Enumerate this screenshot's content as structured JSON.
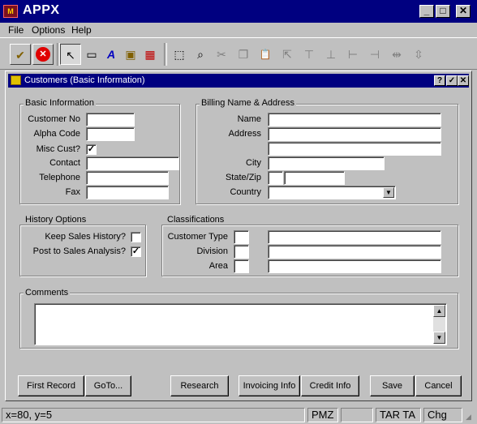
{
  "app": {
    "title": "APPX",
    "logo_text": "M"
  },
  "menu": [
    "File",
    "Options",
    "Help"
  ],
  "toolbar": {
    "tools": [
      {
        "icon": "checkbox-edit-icon",
        "glyph": "✔"
      },
      {
        "icon": "cancel-icon",
        "glyph": "✕"
      },
      {
        "icon": "pointer-icon",
        "glyph": "↖"
      },
      {
        "icon": "rectangle-icon",
        "glyph": "▭"
      },
      {
        "icon": "text-tool-icon",
        "glyph": "A"
      },
      {
        "icon": "image-icon",
        "glyph": "▣"
      },
      {
        "icon": "calendar-icon",
        "glyph": "▦"
      },
      {
        "icon": "select-box-icon",
        "glyph": "⬚"
      },
      {
        "icon": "find-icon",
        "glyph": "⌕"
      },
      {
        "icon": "cut-icon",
        "glyph": "✂"
      },
      {
        "icon": "copy-icon",
        "glyph": "❐"
      },
      {
        "icon": "paste-icon",
        "glyph": "📋"
      },
      {
        "icon": "export-icon",
        "glyph": "⇱"
      },
      {
        "icon": "align-top-icon",
        "glyph": "⊤"
      },
      {
        "icon": "align-bottom-icon",
        "glyph": "⊥"
      },
      {
        "icon": "align-left-icon",
        "glyph": "⊢"
      },
      {
        "icon": "align-right-icon",
        "glyph": "⊣"
      },
      {
        "icon": "same-width-icon",
        "glyph": "⇹"
      },
      {
        "icon": "same-height-icon",
        "glyph": "⇳"
      }
    ]
  },
  "window": {
    "title": "Customers (Basic Information)",
    "help_btn": "?",
    "ok_btn": "✓",
    "close_btn": "✕"
  },
  "basic": {
    "group_label": "Basic Information",
    "customer_no": "Customer No",
    "alpha_code": "Alpha Code",
    "misc_cust": "Misc Cust?",
    "misc_cust_checked": "✓",
    "contact": "Contact",
    "telephone": "Telephone",
    "fax": "Fax"
  },
  "billing": {
    "group_label": "Billing Name & Address",
    "name": "Name",
    "address": "Address",
    "city": "City",
    "state_zip": "State/Zip",
    "country": "Country",
    "country_arrow": "▼"
  },
  "history": {
    "group_label": "History Options",
    "keep_sales": "Keep Sales History?",
    "keep_sales_checked": "",
    "post_sales": "Post to Sales Analysis?",
    "post_sales_checked": "✓"
  },
  "classifications": {
    "group_label": "Classifications",
    "customer_type": "Customer Type",
    "division": "Division",
    "area": "Area"
  },
  "comments": {
    "group_label": "Comments",
    "up": "▲",
    "down": "▼"
  },
  "buttons": {
    "first_record": "First Record",
    "goto": "GoTo...",
    "research": "Research",
    "invoicing_info": "Invoicing Info",
    "credit_info": "Credit Info",
    "save": "Save",
    "cancel": "Cancel"
  },
  "status": {
    "coords": "x=80, y=5",
    "mode": "PMZ",
    "blank": "",
    "tarta": "TAR TA",
    "chg": "Chg"
  }
}
